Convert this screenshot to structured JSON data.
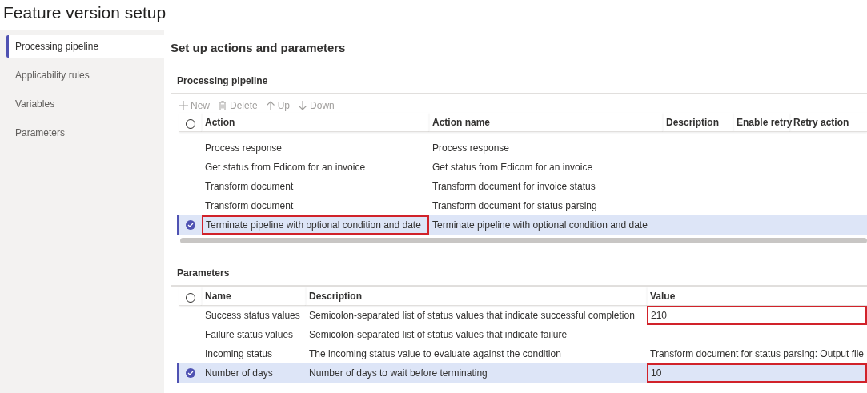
{
  "window": {
    "title": "Feature version setup"
  },
  "sidebar": {
    "items": [
      {
        "label": "Processing pipeline",
        "selected": true
      },
      {
        "label": "Applicability rules",
        "selected": false
      },
      {
        "label": "Variables",
        "selected": false
      },
      {
        "label": "Parameters",
        "selected": false
      }
    ]
  },
  "main": {
    "heading": "Set up actions and parameters"
  },
  "pipeline": {
    "title": "Processing pipeline",
    "toolbar": [
      {
        "kind": "new",
        "label": "New",
        "disabled": true
      },
      {
        "kind": "delete",
        "label": "Delete",
        "disabled": true
      },
      {
        "kind": "up",
        "label": "Up",
        "disabled": true
      },
      {
        "kind": "down",
        "label": "Down",
        "disabled": true
      }
    ],
    "select_all": {
      "checked": false
    },
    "columns": [
      "Action",
      "Action name",
      "Description",
      "Enable retry",
      "Retry action"
    ],
    "rows": [
      {
        "cells": [
          "Process response",
          "Process response"
        ],
        "selected": false,
        "highlighted": false
      },
      {
        "cells": [
          "Get status from Edicom for an invoice",
          "Get status from Edicom for an invoice"
        ],
        "selected": false,
        "highlighted": false
      },
      {
        "cells": [
          "Transform document",
          "Transform document for invoice status"
        ],
        "selected": false,
        "highlighted": false
      },
      {
        "cells": [
          "Transform document",
          "Transform document for status parsing"
        ],
        "selected": false,
        "highlighted": false
      },
      {
        "cells": [
          "Terminate pipeline with optional condition and date",
          "Terminate pipeline with optional condition and date"
        ],
        "selected": true,
        "highlighted": true
      }
    ]
  },
  "parameters": {
    "title": "Parameters",
    "select_all": {
      "checked": false
    },
    "columns": [
      "Name",
      "Description",
      "Value"
    ],
    "rows": [
      {
        "cells": [
          "Success status values",
          "Semicolon-separated list of status values that indicate successful completion",
          "210"
        ],
        "selected": false,
        "highlighted": true
      },
      {
        "cells": [
          "Failure status values",
          "Semicolon-separated list of status values that indicate failure"
        ],
        "selected": false,
        "highlighted": false
      },
      {
        "cells": [
          "Incoming status",
          "The incoming status value to evaluate against the condition",
          "Transform document for status parsing: Output file"
        ],
        "selected": false,
        "highlighted": false
      },
      {
        "cells": [
          "Number of days",
          "Number of days to wait before terminating",
          "10"
        ],
        "selected": true,
        "highlighted": true
      }
    ]
  }
}
